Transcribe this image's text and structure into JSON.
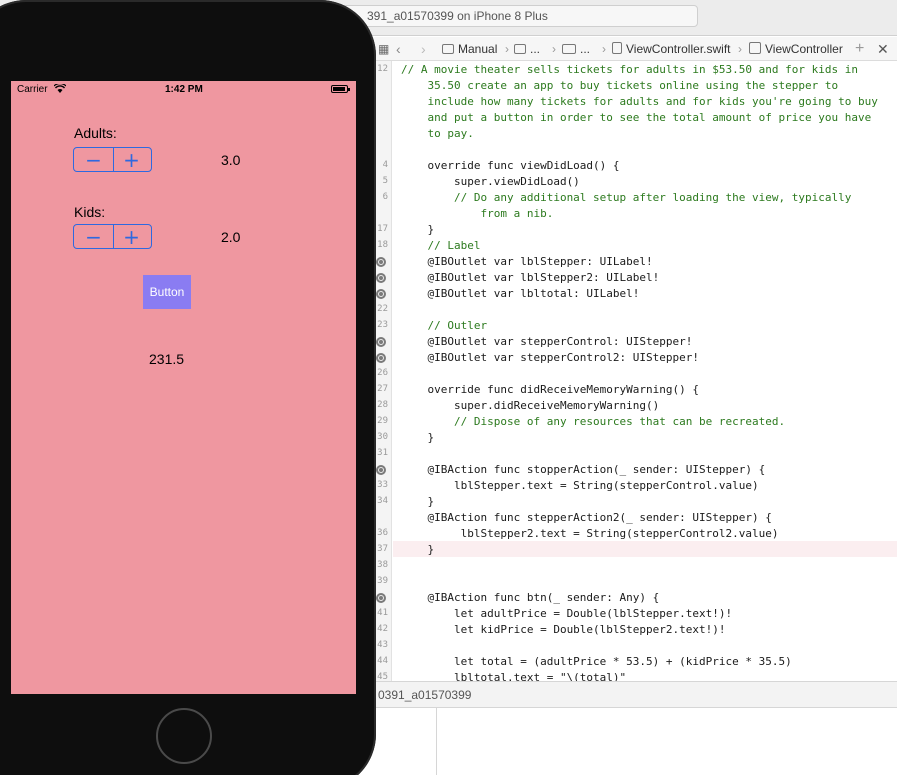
{
  "xcode": {
    "scheme_text": "391_a01570399 on iPhone 8 Plus",
    "jumpbar": {
      "manual": "Manual",
      "ellipsis1": "...",
      "ellipsis2": "...",
      "file": "ViewController.swift",
      "symbol": "ViewController"
    },
    "code_lines": [
      {
        "num": "12",
        "text": "// A movie theater sells tickets for adults in $53.50 and for kids in"
      },
      {
        "num": "",
        "text": "    35.50 create an app to buy tickets online using the stepper to"
      },
      {
        "num": "",
        "text": "    include how many tickets for adults and for kids you're going to buy"
      },
      {
        "num": "",
        "text": "    and put a button in order to see the total amount of price you have"
      },
      {
        "num": "",
        "text": "    to pay."
      },
      {
        "num": "",
        "text": ""
      },
      {
        "num": "4",
        "text": "    override func viewDidLoad() {"
      },
      {
        "num": "5",
        "text": "        super.viewDidLoad()"
      },
      {
        "num": "6",
        "text": "        // Do any additional setup after loading the view, typically"
      },
      {
        "num": "",
        "text": "            from a nib."
      },
      {
        "num": "17",
        "text": "    }"
      },
      {
        "num": "18",
        "text": "    // Label"
      },
      {
        "num": "",
        "text": "    @IBOutlet var lblStepper: UILabel!"
      },
      {
        "num": "",
        "text": "    @IBOutlet var lblStepper2: UILabel!"
      },
      {
        "num": "",
        "text": "    @IBOutlet var lbltotal: UILabel!"
      },
      {
        "num": "22",
        "text": ""
      },
      {
        "num": "23",
        "text": "    // Outler"
      },
      {
        "num": "",
        "text": "    @IBOutlet var stepperControl: UIStepper!"
      },
      {
        "num": "",
        "text": "    @IBOutlet var stepperControl2: UIStepper!"
      },
      {
        "num": "26",
        "text": ""
      },
      {
        "num": "27",
        "text": "    override func didReceiveMemoryWarning() {"
      },
      {
        "num": "28",
        "text": "        super.didReceiveMemoryWarning()"
      },
      {
        "num": "29",
        "text": "        // Dispose of any resources that can be recreated."
      },
      {
        "num": "30",
        "text": "    }"
      },
      {
        "num": "31",
        "text": ""
      },
      {
        "num": "",
        "text": "    @IBAction func stopperAction(_ sender: UIStepper) {"
      },
      {
        "num": "33",
        "text": "        lblStepper.text = String(stepperControl.value)"
      },
      {
        "num": "34",
        "text": "    }"
      },
      {
        "num": "",
        "text": "    @IBAction func stepperAction2(_ sender: UIStepper) {"
      },
      {
        "num": "36",
        "text": "         lblStepper2.text = String(stepperControl2.value)"
      },
      {
        "num": "37",
        "text": "    }"
      },
      {
        "num": "38",
        "text": ""
      },
      {
        "num": "39",
        "text": ""
      },
      {
        "num": "",
        "text": "    @IBAction func btn(_ sender: Any) {"
      },
      {
        "num": "41",
        "text": "        let adultPrice = Double(lblStepper.text!)!"
      },
      {
        "num": "42",
        "text": "        let kidPrice = Double(lblStepper2.text!)!"
      },
      {
        "num": "43",
        "text": ""
      },
      {
        "num": "44",
        "text": "        let total = (adultPrice * 53.5) + (kidPrice * 35.5)"
      },
      {
        "num": "45",
        "text": "        lbltotal.text = \"\\(total)\""
      }
    ],
    "debug_title": "0391_a01570399"
  },
  "simulator": {
    "status": {
      "carrier": "Carrier",
      "time": "1:42 PM"
    },
    "adults_label": "Adults:",
    "adults_value": "3.0",
    "kids_label": "Kids:",
    "kids_value": "2.0",
    "stepper_minus": "−",
    "stepper_plus": "+",
    "button_label": "Button",
    "total_value": "231.5"
  },
  "colors": {
    "screen_background": "#ef97a0",
    "stepper_tint": "#2e69e0",
    "button_background": "#8a7cf2"
  }
}
